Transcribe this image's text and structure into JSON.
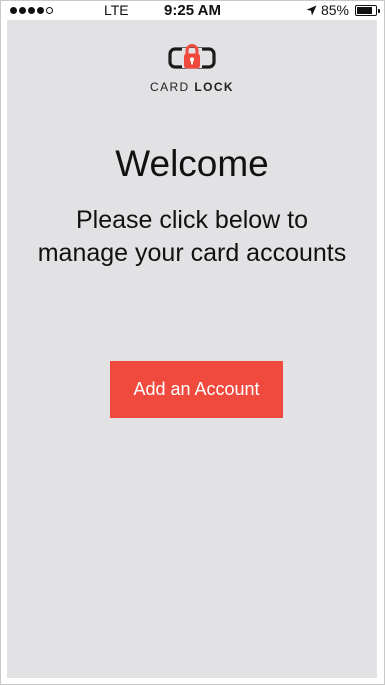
{
  "status_bar": {
    "network": "LTE",
    "time": "9:25 AM",
    "battery_percent": "85%",
    "battery_level": 0.85,
    "signal_bars": 4,
    "signal_total": 5
  },
  "logo": {
    "icon": "padlock-card-icon",
    "text_light": "CARD ",
    "text_bold": "LOCK",
    "accent_color": "#ef4a3d"
  },
  "main": {
    "title": "Welcome",
    "instructions": "Please click below to manage your card accounts",
    "add_button_label": "Add an Account",
    "background_color": "#e2e2e5",
    "button_color": "#ef4a3d"
  }
}
